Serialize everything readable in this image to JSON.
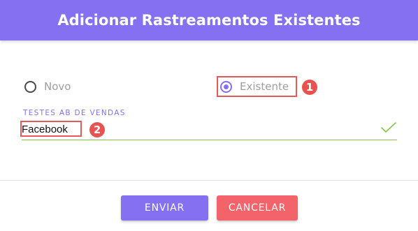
{
  "dialog": {
    "title": "Adicionar Rastreamentos Existentes"
  },
  "tracking_type": {
    "options": [
      {
        "label": "Novo",
        "selected": false
      },
      {
        "label": "Existente",
        "selected": true
      }
    ]
  },
  "field": {
    "label": "TESTES AB DE VENDAS",
    "value": "Facebook",
    "valid": true
  },
  "annotations": {
    "step_1": "1",
    "step_2": "2",
    "highlight_color": "#e45a5a"
  },
  "actions": {
    "submit_label": "ENVIAR",
    "cancel_label": "CANCELAR"
  },
  "colors": {
    "primary": "#8470f0",
    "danger": "#f2636a",
    "success": "#8bc34a"
  }
}
